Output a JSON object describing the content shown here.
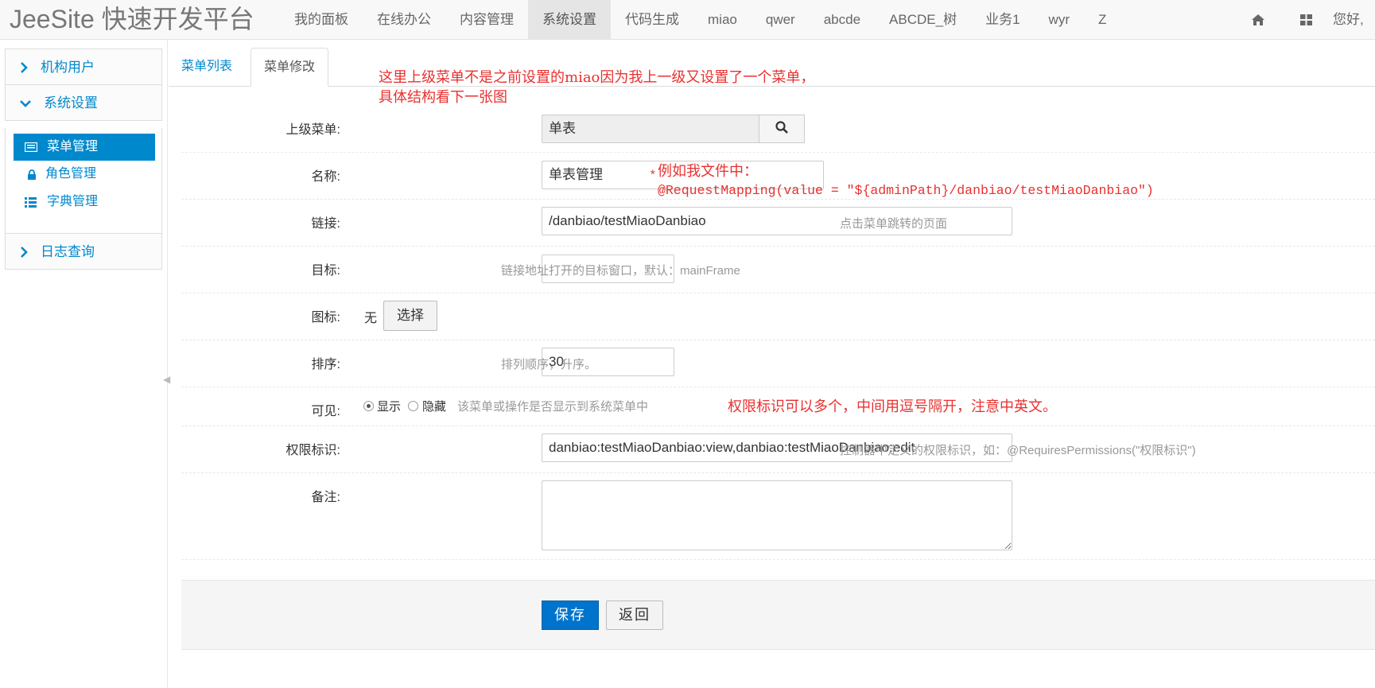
{
  "brand": "JeeSite 快速开发平台",
  "nav": {
    "items": [
      {
        "label": "我的面板",
        "active": false
      },
      {
        "label": "在线办公",
        "active": false
      },
      {
        "label": "内容管理",
        "active": false
      },
      {
        "label": "系统设置",
        "active": true
      },
      {
        "label": "代码生成",
        "active": false
      },
      {
        "label": "miao",
        "active": false
      },
      {
        "label": "qwer",
        "active": false
      },
      {
        "label": "abcde",
        "active": false
      },
      {
        "label": "ABCDE_树",
        "active": false
      },
      {
        "label": "业务1",
        "active": false
      },
      {
        "label": "wyr",
        "active": false
      },
      {
        "label": "Z",
        "active": false
      }
    ],
    "home_icon": "home-icon",
    "grid_icon": "grid-icon",
    "greeting": "您好,"
  },
  "sidebar": {
    "sections": [
      {
        "label": "机构用户"
      },
      {
        "label": "系统设置"
      },
      {
        "label": "日志查询"
      }
    ],
    "items": [
      {
        "label": "菜单管理",
        "icon": "list-card-icon",
        "active": true
      },
      {
        "label": "角色管理",
        "icon": "lock-icon",
        "active": false
      },
      {
        "label": "字典管理",
        "icon": "th-list-icon",
        "active": false
      }
    ]
  },
  "tabs": {
    "list": "菜单列表",
    "edit": "菜单修改"
  },
  "form": {
    "parent": {
      "label": "上级菜单:",
      "value": "单表"
    },
    "name": {
      "label": "名称:",
      "value": "单表管理",
      "required": "*"
    },
    "href": {
      "label": "链接:",
      "value": "/danbiao/testMiaoDanbiao",
      "help": "点击菜单跳转的页面"
    },
    "target": {
      "label": "目标:",
      "value": "",
      "help": "链接地址打开的目标窗口，默认：mainFrame"
    },
    "icon": {
      "label": "图标:",
      "value": "无",
      "button": "选择"
    },
    "sort": {
      "label": "排序:",
      "value": "30",
      "help": "排列顺序，升序。"
    },
    "visible": {
      "label": "可见:",
      "option_show": "显示",
      "option_hide": "隐藏",
      "selected": "显示",
      "help": "该菜单或操作是否显示到系统菜单中"
    },
    "permission": {
      "label": "权限标识:",
      "value": "danbiao:testMiaoDanbiao:view,danbiao:testMiaoDanbiao:edit",
      "help": "控制器中定义的权限标识，如：@RequiresPermissions(\"权限标识\")"
    },
    "remarks": {
      "label": "备注:",
      "value": ""
    }
  },
  "actions": {
    "save": "保存",
    "back": "返回"
  },
  "annotations": {
    "note1_line1": "这里上级菜单不是之前设置的miao因为我上一级又设置了一个菜单，",
    "note1_line2": "具体结构看下一张图",
    "note2_line1": "例如我文件中：",
    "note2_line2": "@RequestMapping(value = \"${adminPath}/danbiao/testMiaoDanbiao\")",
    "note3": "权限标识可以多个，中间用逗号隔开，注意中英文。"
  }
}
